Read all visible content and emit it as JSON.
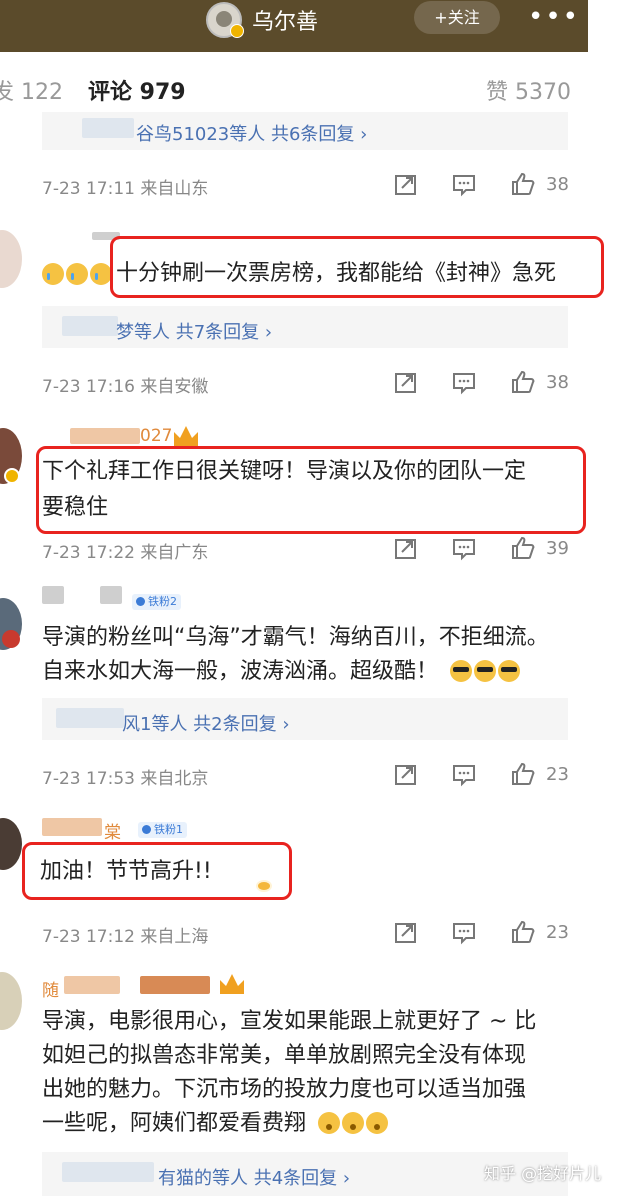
{
  "header": {
    "account_name": "乌尔善",
    "follow_label": "+关注",
    "more_label": "•••"
  },
  "tabs": [
    {
      "label": "发 122"
    },
    {
      "label": "评论 979"
    },
    {
      "label": "赞 5370"
    }
  ],
  "icons": {
    "share": "share-icon",
    "comment": "comment-icon",
    "like": "thumbs-up-icon"
  },
  "accent_color": "#f2a51a",
  "highlight_color": "#e8231f",
  "comments": [
    {
      "reply_text": "谷鸟51023等人 共6条回复 ›",
      "meta": "7-23 17:11 来自山东",
      "likes": "38"
    },
    {
      "text": "十分钟刷一次票房榜，我都能给《封神》急死",
      "reply_text": "梦等人 共7条回复 ›",
      "meta": "7-23 17:16 来自安徽",
      "likes": "38"
    },
    {
      "username_fragment": "027",
      "text_line1": "下个礼拜工作日很关键呀！导演以及你的团队一定",
      "text_line2": "要稳住",
      "meta": "7-23 17:22 来自广东",
      "likes": "39"
    },
    {
      "fan_badge": "铁粉2",
      "text_line1": "导演的粉丝叫“乌海”才霸气！海纳百川，不拒细流。",
      "text_line2": "自来水如大海一般，波涛汹涌。超级酷！",
      "reply_text": "风1等人 共2条回复 ›",
      "meta": "7-23 17:53 来自北京",
      "likes": "23"
    },
    {
      "username_fragment": "棠",
      "fan_badge": "铁粉1",
      "text": "加油！节节高升!!",
      "meta": "7-23 17:12 来自上海",
      "likes": "23"
    },
    {
      "username_fragment": "随",
      "text_line1": "导演，电影很用心，宣发如果能跟上就更好了 ~ 比",
      "text_line2": "如妲己的拟兽态非常美，单单放剧照完全没有体现",
      "text_line3": "出她的魅力。下沉市场的投放力度也可以适当加强",
      "text_line4": "一些呢，阿姨们都爱看费翔",
      "reply_text": "有猫的等人 共4条回复 ›"
    }
  ],
  "watermark": "知乎 @挖好片儿"
}
